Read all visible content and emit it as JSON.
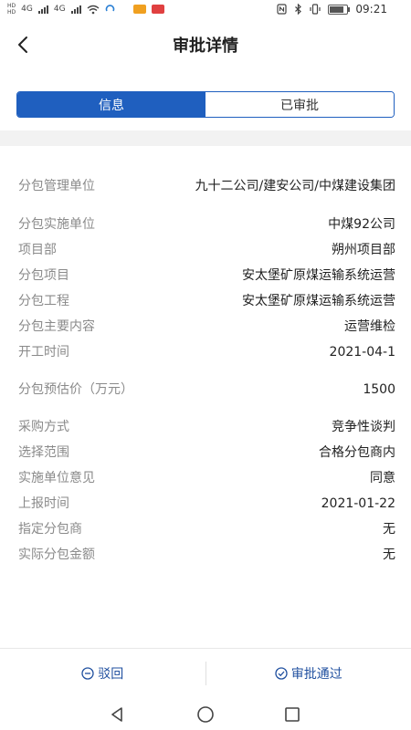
{
  "status_bar": {
    "hd_top": "HD",
    "hd_bottom": "HD",
    "network_1": "4G",
    "network_2": "4G",
    "time": "09:21",
    "icons": [
      "nfc-icon",
      "bluetooth-icon",
      "vibrate-icon",
      "battery-icon"
    ]
  },
  "header": {
    "title": "审批详情",
    "back_icon": "chevron-left-icon"
  },
  "tabs": [
    {
      "label": "信息",
      "active": true
    },
    {
      "label": "已审批",
      "active": false
    }
  ],
  "fields": [
    {
      "label": "分包管理单位",
      "value": "九十二公司/建安公司/中煤建设集团"
    },
    {
      "label": "分包实施单位",
      "value": "中煤92公司"
    },
    {
      "label": "项目部",
      "value": "朔州项目部"
    },
    {
      "label": "分包项目",
      "value": "安太堡矿原煤运输系统运营"
    },
    {
      "label": "分包工程",
      "value": "安太堡矿原煤运输系统运营"
    },
    {
      "label": "分包主要内容",
      "value": "运营维检"
    },
    {
      "label": "开工时间",
      "value": "2021-04-1"
    },
    {
      "label": "分包预估价（万元）",
      "value": "1500"
    },
    {
      "label": "采购方式",
      "value": "竞争性谈判"
    },
    {
      "label": "选择范围",
      "value": "合格分包商内"
    },
    {
      "label": "实施单位意见",
      "value": "同意"
    },
    {
      "label": "上报时间",
      "value": "2021-01-22"
    },
    {
      "label": "指定分包商",
      "value": "无"
    },
    {
      "label": "实际分包金额",
      "value": "无"
    }
  ],
  "actions": {
    "reject_label": "驳回",
    "approve_label": "审批通过"
  },
  "colors": {
    "accent": "#1f5fbf",
    "action_text": "#1f4f9f",
    "label_gray": "#8a8a8a"
  }
}
